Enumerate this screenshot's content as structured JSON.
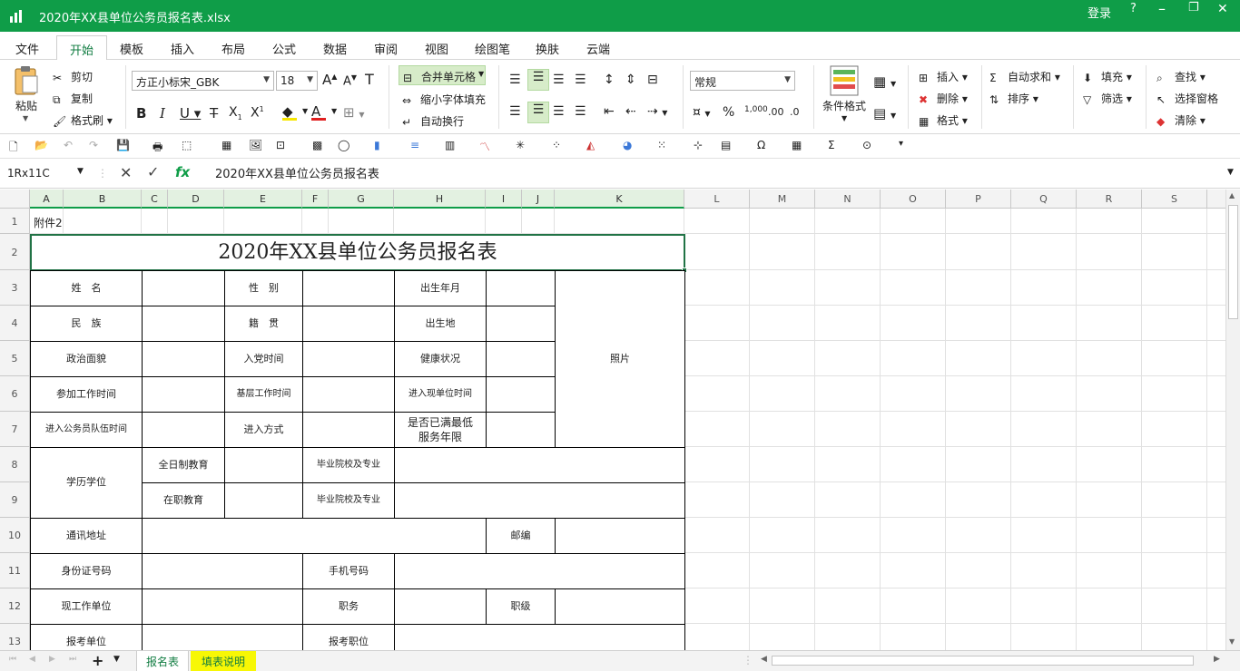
{
  "window": {
    "title": "2020年XX县单位公务员报名表.xlsx",
    "login": "登录",
    "help": "?"
  },
  "menu": [
    "文件",
    "开始",
    "模板",
    "插入",
    "布局",
    "公式",
    "数据",
    "审阅",
    "视图",
    "绘图笔",
    "换肤",
    "云端"
  ],
  "ribbon": {
    "paste": "粘贴",
    "cut": "剪切",
    "copy": "复制",
    "format_painter": "格式刷",
    "font_name": "方正小标宋_GBK",
    "font_size": "18",
    "merge": "合并单元格",
    "shrink": "缩小字体填充",
    "wrap": "自动换行",
    "number_format": "常规",
    "conditional": "条件格式",
    "insert": "插入",
    "delete": "删除",
    "format": "格式",
    "autosum": "自动求和",
    "sort": "排序",
    "fill": "填充",
    "filter": "筛选",
    "find": "查找",
    "select_pane": "选择窗格",
    "clear": "清除"
  },
  "formula_bar": {
    "name_box": "1Rx11C",
    "fx": "fx",
    "content": "2020年XX县单位公务员报名表"
  },
  "columns": [
    "A",
    "B",
    "C",
    "D",
    "E",
    "F",
    "G",
    "H",
    "I",
    "J",
    "K",
    "L",
    "M",
    "N",
    "O",
    "P",
    "Q",
    "R",
    "S"
  ],
  "rows": [
    "1",
    "2",
    "3",
    "4",
    "5",
    "6",
    "7",
    "8",
    "9",
    "10",
    "11",
    "12",
    "13"
  ],
  "sheet": {
    "a1": "附件2",
    "title": "2020年XX县单位公务员报名表",
    "name": "姓　名",
    "gender": "性　别",
    "birth": "出生年月",
    "ethnic": "民　族",
    "native": "籍　贯",
    "birthplace": "出生地",
    "political": "政治面貌",
    "party_time": "入党时间",
    "health": "健康状况",
    "work_time": "参加工作时间",
    "grassroots": "基层工作时间",
    "join_unit": "进入现单位时间",
    "join_cs": "进入公务员队伍时间",
    "join_way": "进入方式",
    "min_years": "是否已满最低服务年限",
    "photo": "照片",
    "education": "学历学位",
    "fulltime": "全日制教育",
    "graduated1": "毕业院校及专业",
    "inservice": "在职教育",
    "graduated2": "毕业院校及专业",
    "address": "通讯地址",
    "postcode": "邮编",
    "id": "身份证号码",
    "mobile": "手机号码",
    "current_unit": "现工作单位",
    "position": "职务",
    "rank": "职级",
    "apply_unit": "报考单位",
    "apply_position": "报考职位"
  },
  "tabs": [
    "报名表",
    "填表说明"
  ],
  "colors": {
    "brand": "#0f9d48",
    "tab_highlight": "#f7f705"
  }
}
